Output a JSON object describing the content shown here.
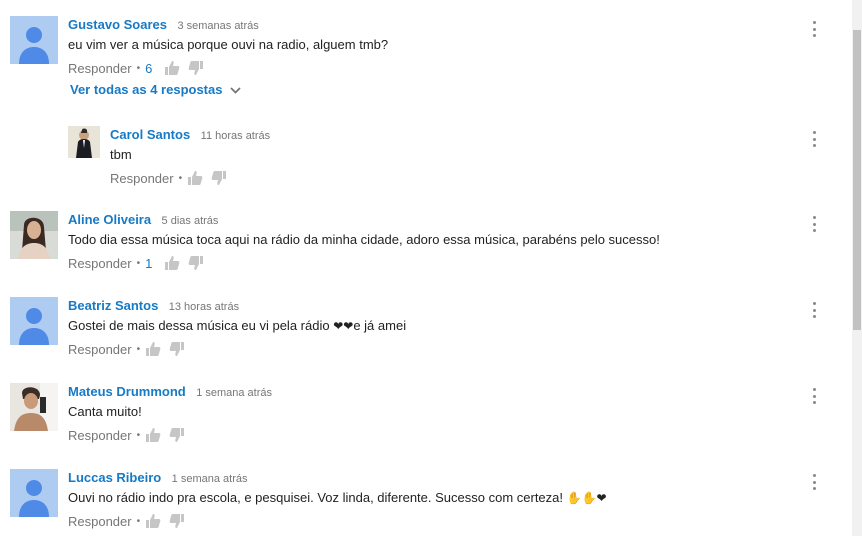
{
  "comments": [
    {
      "author": "Gustavo Soares",
      "time": "3 semanas atrás",
      "text": "eu vim ver a música porque ouvi na radio, alguem tmb?",
      "reply_label": "Responder",
      "likes": "6",
      "avatar": "default",
      "view_replies": "Ver todas as 4 respostas"
    },
    {
      "author": "Carol Santos",
      "time": "11 horas atrás",
      "text": "tbm",
      "reply_label": "Responder",
      "likes": "",
      "avatar": "photo-man-suit"
    },
    {
      "author": "Aline Oliveira",
      "time": "5 dias atrás",
      "text": "Todo dia essa música toca aqui na rádio da minha cidade, adoro essa música, parabéns pelo sucesso!",
      "reply_label": "Responder",
      "likes": "1",
      "avatar": "photo-woman"
    },
    {
      "author": "Beatriz Santos",
      "time": "13 horas atrás",
      "text": "Gostei de mais dessa música eu vi pela rádio",
      "text_suffix": "e já amei",
      "reply_label": "Responder",
      "likes": "",
      "avatar": "default"
    },
    {
      "author": "Mateus Drummond",
      "time": "1 semana atrás",
      "text": "Canta muito!",
      "reply_label": "Responder",
      "likes": "",
      "avatar": "photo-man-selfie"
    },
    {
      "author": "Luccas Ribeiro",
      "time": "1 semana atrás",
      "text": "Ouvi no rádio indo pra escola, e pesquisei. Voz linda, diferente. Sucesso com certeza!",
      "reply_label": "Responder",
      "likes": "",
      "avatar": "default"
    }
  ],
  "bullet": "•",
  "colors": {
    "author": "#167ac6",
    "meta": "#767676",
    "text": "#222222",
    "default_avatar_bg": "#a6c5ef",
    "default_avatar_fg": "#4a86e8"
  }
}
